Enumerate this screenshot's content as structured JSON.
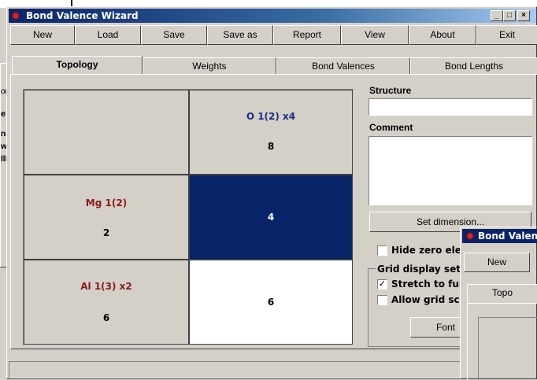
{
  "window": {
    "title": "Bond Valence Wizard",
    "minimize": "_",
    "maximize": "□",
    "close": "×"
  },
  "menu": {
    "new": "New",
    "load": "Load",
    "save": "Save",
    "save_as": "Save as",
    "report": "Report",
    "view": "View",
    "about": "About",
    "exit": "Exit"
  },
  "tabs": [
    "Topology",
    "Weights",
    "Bond Valences",
    "Bond Lengths"
  ],
  "grid": {
    "column_header": {
      "name": "O 1(2) x4",
      "value": "8"
    },
    "rows": [
      {
        "name": "Mg 1(2)",
        "value": "2",
        "cell": "4"
      },
      {
        "name": "Al 1(3) x2",
        "value": "6",
        "cell": "6"
      }
    ]
  },
  "right_panel": {
    "structure_label": "Structure",
    "structure_value": "",
    "comment_label": "Comment",
    "comment_value": "",
    "set_dimension": "Set dimension...",
    "hide_zero": "Hide zero ele",
    "hide_zero_checked": false,
    "grid_display_group": "Grid display set",
    "stretch": "Stretch to ful",
    "stretch_checked": true,
    "allow_scroll": "Allow grid scr",
    "allow_scroll_checked": false,
    "font_button": "Font"
  },
  "second_window": {
    "title": "Bond Valen",
    "new_button": "New",
    "tab": "Topo"
  },
  "left_fragments": [
    "or",
    "e",
    "ng",
    "wi",
    "lll"
  ],
  "colors": {
    "header_text": "#1a2e8a",
    "row_text": "#8b1a1a",
    "selected_cell": "#0a246a",
    "titlebar": "#0a246a"
  }
}
